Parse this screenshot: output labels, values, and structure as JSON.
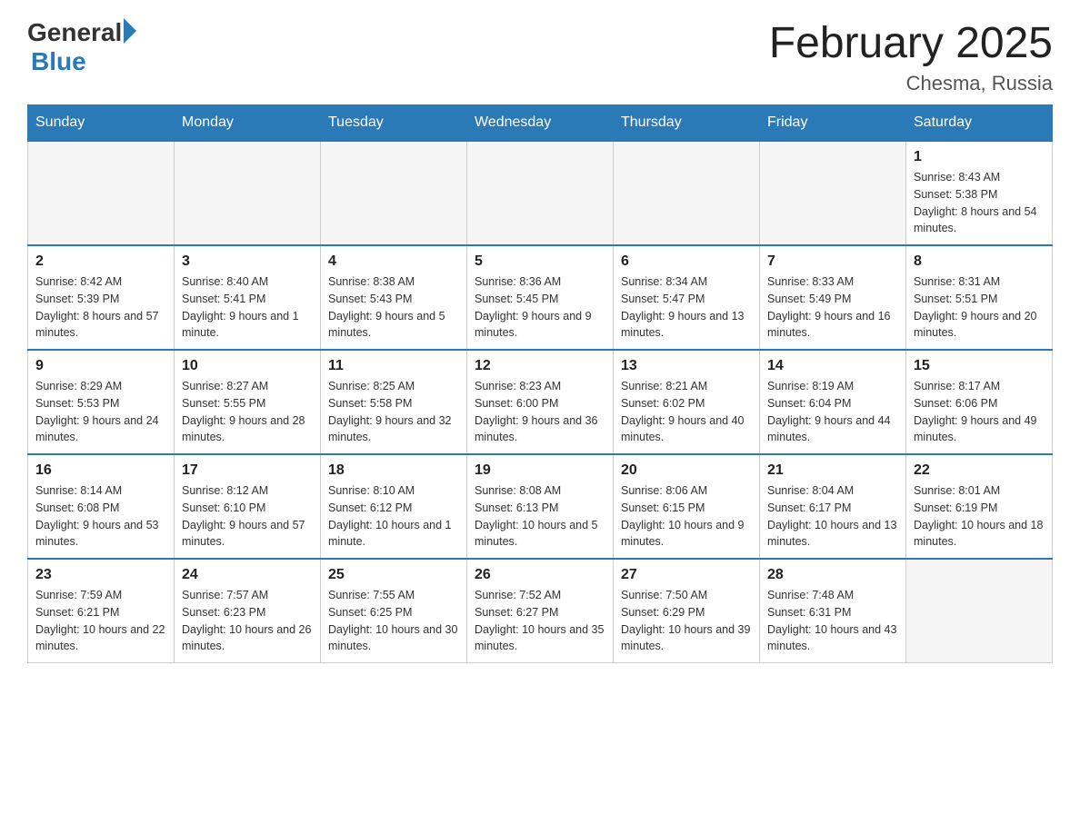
{
  "header": {
    "logo_general": "General",
    "logo_blue": "Blue",
    "month_title": "February 2025",
    "location": "Chesma, Russia"
  },
  "weekdays": [
    "Sunday",
    "Monday",
    "Tuesday",
    "Wednesday",
    "Thursday",
    "Friday",
    "Saturday"
  ],
  "weeks": [
    [
      {
        "day": "",
        "info": ""
      },
      {
        "day": "",
        "info": ""
      },
      {
        "day": "",
        "info": ""
      },
      {
        "day": "",
        "info": ""
      },
      {
        "day": "",
        "info": ""
      },
      {
        "day": "",
        "info": ""
      },
      {
        "day": "1",
        "info": "Sunrise: 8:43 AM\nSunset: 5:38 PM\nDaylight: 8 hours and 54 minutes."
      }
    ],
    [
      {
        "day": "2",
        "info": "Sunrise: 8:42 AM\nSunset: 5:39 PM\nDaylight: 8 hours and 57 minutes."
      },
      {
        "day": "3",
        "info": "Sunrise: 8:40 AM\nSunset: 5:41 PM\nDaylight: 9 hours and 1 minute."
      },
      {
        "day": "4",
        "info": "Sunrise: 8:38 AM\nSunset: 5:43 PM\nDaylight: 9 hours and 5 minutes."
      },
      {
        "day": "5",
        "info": "Sunrise: 8:36 AM\nSunset: 5:45 PM\nDaylight: 9 hours and 9 minutes."
      },
      {
        "day": "6",
        "info": "Sunrise: 8:34 AM\nSunset: 5:47 PM\nDaylight: 9 hours and 13 minutes."
      },
      {
        "day": "7",
        "info": "Sunrise: 8:33 AM\nSunset: 5:49 PM\nDaylight: 9 hours and 16 minutes."
      },
      {
        "day": "8",
        "info": "Sunrise: 8:31 AM\nSunset: 5:51 PM\nDaylight: 9 hours and 20 minutes."
      }
    ],
    [
      {
        "day": "9",
        "info": "Sunrise: 8:29 AM\nSunset: 5:53 PM\nDaylight: 9 hours and 24 minutes."
      },
      {
        "day": "10",
        "info": "Sunrise: 8:27 AM\nSunset: 5:55 PM\nDaylight: 9 hours and 28 minutes."
      },
      {
        "day": "11",
        "info": "Sunrise: 8:25 AM\nSunset: 5:58 PM\nDaylight: 9 hours and 32 minutes."
      },
      {
        "day": "12",
        "info": "Sunrise: 8:23 AM\nSunset: 6:00 PM\nDaylight: 9 hours and 36 minutes."
      },
      {
        "day": "13",
        "info": "Sunrise: 8:21 AM\nSunset: 6:02 PM\nDaylight: 9 hours and 40 minutes."
      },
      {
        "day": "14",
        "info": "Sunrise: 8:19 AM\nSunset: 6:04 PM\nDaylight: 9 hours and 44 minutes."
      },
      {
        "day": "15",
        "info": "Sunrise: 8:17 AM\nSunset: 6:06 PM\nDaylight: 9 hours and 49 minutes."
      }
    ],
    [
      {
        "day": "16",
        "info": "Sunrise: 8:14 AM\nSunset: 6:08 PM\nDaylight: 9 hours and 53 minutes."
      },
      {
        "day": "17",
        "info": "Sunrise: 8:12 AM\nSunset: 6:10 PM\nDaylight: 9 hours and 57 minutes."
      },
      {
        "day": "18",
        "info": "Sunrise: 8:10 AM\nSunset: 6:12 PM\nDaylight: 10 hours and 1 minute."
      },
      {
        "day": "19",
        "info": "Sunrise: 8:08 AM\nSunset: 6:13 PM\nDaylight: 10 hours and 5 minutes."
      },
      {
        "day": "20",
        "info": "Sunrise: 8:06 AM\nSunset: 6:15 PM\nDaylight: 10 hours and 9 minutes."
      },
      {
        "day": "21",
        "info": "Sunrise: 8:04 AM\nSunset: 6:17 PM\nDaylight: 10 hours and 13 minutes."
      },
      {
        "day": "22",
        "info": "Sunrise: 8:01 AM\nSunset: 6:19 PM\nDaylight: 10 hours and 18 minutes."
      }
    ],
    [
      {
        "day": "23",
        "info": "Sunrise: 7:59 AM\nSunset: 6:21 PM\nDaylight: 10 hours and 22 minutes."
      },
      {
        "day": "24",
        "info": "Sunrise: 7:57 AM\nSunset: 6:23 PM\nDaylight: 10 hours and 26 minutes."
      },
      {
        "day": "25",
        "info": "Sunrise: 7:55 AM\nSunset: 6:25 PM\nDaylight: 10 hours and 30 minutes."
      },
      {
        "day": "26",
        "info": "Sunrise: 7:52 AM\nSunset: 6:27 PM\nDaylight: 10 hours and 35 minutes."
      },
      {
        "day": "27",
        "info": "Sunrise: 7:50 AM\nSunset: 6:29 PM\nDaylight: 10 hours and 39 minutes."
      },
      {
        "day": "28",
        "info": "Sunrise: 7:48 AM\nSunset: 6:31 PM\nDaylight: 10 hours and 43 minutes."
      },
      {
        "day": "",
        "info": ""
      }
    ]
  ]
}
